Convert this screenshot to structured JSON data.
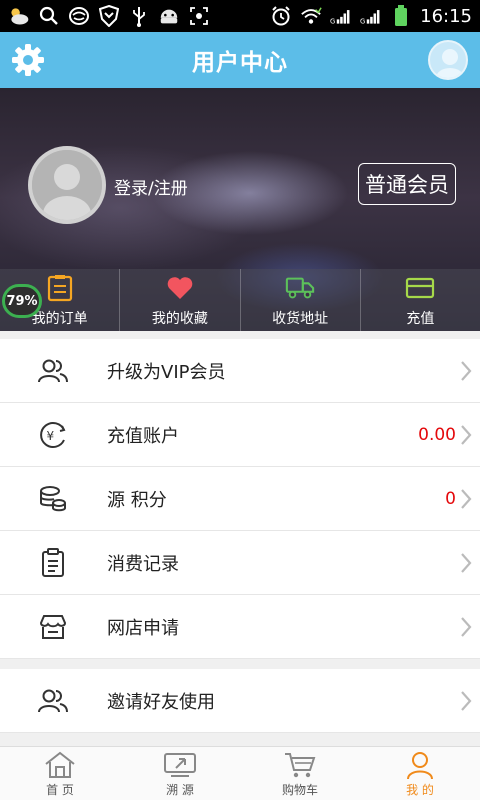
{
  "status_bar": {
    "time": "16:15",
    "icons_left": [
      "weather-icon",
      "search-icon",
      "app-icon",
      "shield-icon",
      "usb-icon",
      "android-icon",
      "screenshot-icon"
    ],
    "icons_right": [
      "alarm-icon",
      "wifi-icon",
      "signal-icon",
      "signal-icon",
      "battery-icon"
    ]
  },
  "header": {
    "title": "用户中心"
  },
  "profile": {
    "login_label": "登录/注册",
    "membership": "普通会员"
  },
  "quick_actions": [
    {
      "label": "我的订单",
      "icon": "order-icon"
    },
    {
      "label": "我的收藏",
      "icon": "heart-icon"
    },
    {
      "label": "收货地址",
      "icon": "truck-icon"
    },
    {
      "label": "充值",
      "icon": "card-icon"
    }
  ],
  "overlay_percent": "79%",
  "menu": [
    {
      "label": "升级为VIP会员",
      "value": "",
      "icon": "users-icon"
    },
    {
      "label": "充值账户",
      "value": "0.00",
      "icon": "yuan-icon"
    },
    {
      "label": "源 积分",
      "value": "0",
      "icon": "coins-icon"
    },
    {
      "label": "消费记录",
      "value": "",
      "icon": "clipboard-icon"
    },
    {
      "label": "网店申请",
      "value": "",
      "icon": "store-icon"
    }
  ],
  "menu2": [
    {
      "label": "邀请好友使用",
      "value": "",
      "icon": "users-icon"
    }
  ],
  "bottom_nav": [
    {
      "label": "首 页",
      "icon": "home-icon",
      "active": false
    },
    {
      "label": "溯 源",
      "icon": "trace-icon",
      "active": false
    },
    {
      "label": "购物车",
      "icon": "cart-icon",
      "active": false
    },
    {
      "label": "我 的",
      "icon": "person-icon",
      "active": true
    }
  ],
  "colors": {
    "header": "#5cbde8",
    "accent": "#f08a1a",
    "value_red": "#e4090c"
  }
}
